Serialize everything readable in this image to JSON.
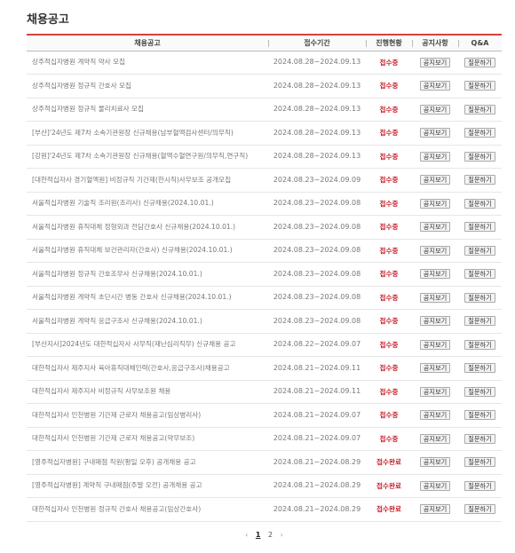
{
  "page": {
    "title": "채용공고"
  },
  "table": {
    "headers": [
      "채용공고",
      "접수기간",
      "진행현황",
      "공지사항",
      "Q&A"
    ],
    "notice_label": "공지보기",
    "qa_label": "질문하기",
    "rows": [
      {
        "title": "상주적십자병원 계약직 약사 모집",
        "period": "2024.08.28~2024.09.13",
        "status": "접수중"
      },
      {
        "title": "상주적십자병원 정규직 간호사 모집",
        "period": "2024.08.28~2024.09.13",
        "status": "접수중"
      },
      {
        "title": "상주적십자병원 정규직 물리치료사 모집",
        "period": "2024.08.28~2024.09.13",
        "status": "접수중"
      },
      {
        "title": "[부산]'24년도 제7차 소속기관원장 신규채용(남부혈액검사센터/의무직)",
        "period": "2024.08.28~2024.09.13",
        "status": "접수중"
      },
      {
        "title": "[강원]'24년도 제7차 소속기관원장 신규채용(혈액수혈연구원/의무직,연구직)",
        "period": "2024.08.28~2024.09.13",
        "status": "접수중"
      },
      {
        "title": "[대한적십자사 경기혈액원] 비정규직 기간제(한시직)사무보조 공개모집",
        "period": "2024.08.23~2024.09.09",
        "status": "접수중"
      },
      {
        "title": "서울적십자병원 기술직 조리원(조리사) 신규채용(2024.10.01.)",
        "period": "2024.08.23~2024.09.08",
        "status": "접수중"
      },
      {
        "title": "서울적십자병원 휴직대체 정형외과 전담간호사 신규채용(2024.10.01.)",
        "period": "2024.08.23~2024.09.08",
        "status": "접수중"
      },
      {
        "title": "서울적십자병원 휴직대체 보건관리자(간호사) 신규채용(2024.10.01.)",
        "period": "2024.08.23~2024.09.08",
        "status": "접수중"
      },
      {
        "title": "서울적십자병원 정규직 간호조무사 신규채용(2024.10.01.)",
        "period": "2024.08.23~2024.09.08",
        "status": "접수중"
      },
      {
        "title": "서울적십자병원 계약직 초단시간 병동 간호사 신규채용(2024.10.01.)",
        "period": "2024.08.23~2024.09.08",
        "status": "접수중"
      },
      {
        "title": "서울적십자병원 계약직 응급구조사 신규채용(2024.10.01.)",
        "period": "2024.08.23~2024.09.08",
        "status": "접수중"
      },
      {
        "title": "[부산지사]2024년도 대한적십자사 사무직(재난심리직무) 신규채용 공고",
        "period": "2024.08.22~2024.09.07",
        "status": "접수중"
      },
      {
        "title": "대한적십자사 제주지사 육아휴직대체인력(간호사,응급구조사)채용공고",
        "period": "2024.08.21~2024.09.11",
        "status": "접수중"
      },
      {
        "title": "대한적십자사 제주지사 비정규직 사무보조원 채용",
        "period": "2024.08.21~2024.09.11",
        "status": "접수중"
      },
      {
        "title": "대한적십자사 인천병원 기간제 근로자 채용공고(임상병리사)",
        "period": "2024.08.21~2024.09.07",
        "status": "접수중"
      },
      {
        "title": "대한적십자사 인천병원 기간제 근로자 채용공고(약무보조)",
        "period": "2024.08.21~2024.09.07",
        "status": "접수중"
      },
      {
        "title": "[영주적십자병원] 구내매점 직원(평일 오후) 공개채용 공고",
        "period": "2024.08.21~2024.08.29",
        "status": "접수완료"
      },
      {
        "title": "[영주적십자병원] 계약직 구내매점(주말 오전) 공개채용 공고",
        "period": "2024.08.21~2024.08.29",
        "status": "접수완료"
      },
      {
        "title": "대한적십자사 인천병원 정규직 간호사 채용공고(임상간호사)",
        "period": "2024.08.21~2024.08.29",
        "status": "접수완료"
      }
    ]
  },
  "pagination": {
    "prev": "‹",
    "pages": [
      "1",
      "2"
    ],
    "current": "1",
    "next": "›"
  }
}
